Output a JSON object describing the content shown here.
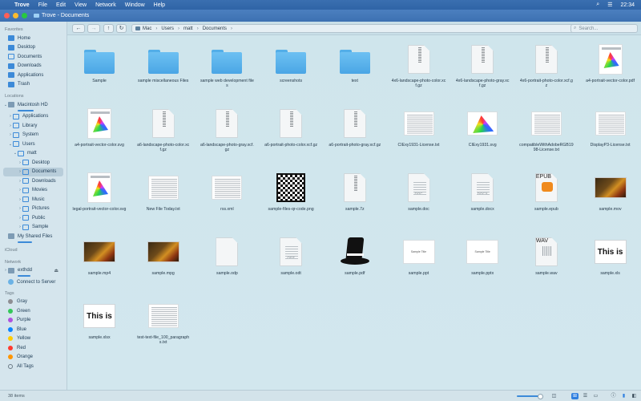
{
  "menubar": {
    "app_name": "Trove",
    "items": [
      "File",
      "Edit",
      "View",
      "Network",
      "Window",
      "Help"
    ],
    "clock": "22:34"
  },
  "window": {
    "title": "Trove - Documents"
  },
  "toolbar": {
    "path": [
      "Mac",
      "Users",
      "matt",
      "Documents"
    ],
    "search_placeholder": "Search..."
  },
  "sidebar": {
    "favorites_header": "Favorites",
    "favorites": [
      "Home",
      "Desktop",
      "Documents",
      "Downloads",
      "Applications",
      "Trash"
    ],
    "locations_header": "Locations",
    "locations": [
      "Macintosh HD",
      "Applications",
      "Library",
      "System",
      "Users",
      "matt",
      "Desktop",
      "Documents",
      "Downloads",
      "Movies",
      "Music",
      "Pictures",
      "Public",
      "Sample",
      "My Shared Files"
    ],
    "icloud_header": "iCloud",
    "network_header": "Network",
    "network": [
      "exthdd",
      "Connect to Server"
    ],
    "tags_header": "Tags",
    "tags": [
      {
        "name": "Gray",
        "color": "#8e8e93"
      },
      {
        "name": "Green",
        "color": "#34c759"
      },
      {
        "name": "Purple",
        "color": "#af52de"
      },
      {
        "name": "Blue",
        "color": "#0a84ff"
      },
      {
        "name": "Yellow",
        "color": "#ffcc00"
      },
      {
        "name": "Red",
        "color": "#ff3b30"
      },
      {
        "name": "Orange",
        "color": "#ff9500"
      },
      {
        "name": "All Tags",
        "color": ""
      }
    ]
  },
  "files": [
    {
      "name": "Sample",
      "kind": "folder"
    },
    {
      "name": "sample miscellaneous Files",
      "kind": "folder"
    },
    {
      "name": "sample web development files",
      "kind": "folder"
    },
    {
      "name": "screenshots",
      "kind": "folder"
    },
    {
      "name": "text",
      "kind": "folder"
    },
    {
      "name": "4x6-landscape-photo-color.xcf.gz",
      "kind": "gz"
    },
    {
      "name": "4x6-landscape-photo-gray.xcf.gz",
      "kind": "gz"
    },
    {
      "name": "4x6-portrait-photo-color.xcf.gz",
      "kind": "gz"
    },
    {
      "name": "a4-portrait-vector-color.pdf",
      "kind": "gamut"
    },
    {
      "name": "a4-portrait-vector-color.svg",
      "kind": "gamut"
    },
    {
      "name": "a6-landscape-photo-color.xcf.gz",
      "kind": "gz"
    },
    {
      "name": "a6-landscape-photo-gray.xcf.gz",
      "kind": "gz"
    },
    {
      "name": "a6-portrait-photo-color.xcf.gz",
      "kind": "gz"
    },
    {
      "name": "a6-portrait-photo-gray.xcf.gz",
      "kind": "gz"
    },
    {
      "name": "CIExy1931-License.txt",
      "kind": "textdoc"
    },
    {
      "name": "CIExy1931.svg",
      "kind": "gamutwide"
    },
    {
      "name": "compatibleWithAdobeRGB1998-License.txt",
      "kind": "textdoc"
    },
    {
      "name": "DisplayP3-License.txt",
      "kind": "textdoc"
    },
    {
      "name": "legal-portrait-vector-color.svg",
      "kind": "gamut"
    },
    {
      "name": "New File Today.txt",
      "kind": "blank"
    },
    {
      "name": "rss.xml",
      "kind": "textdoc"
    },
    {
      "name": "sample-files-qr-code.png",
      "kind": "qr"
    },
    {
      "name": "sample.7z",
      "kind": "gz"
    },
    {
      "name": "sample.doc",
      "kind": "docx",
      "ext": "DOC"
    },
    {
      "name": "sample.docx",
      "kind": "docx",
      "ext": "DOCX"
    },
    {
      "name": "sample.epub",
      "kind": "epub",
      "ext": "EPUB"
    },
    {
      "name": "sample.mov",
      "kind": "photo"
    },
    {
      "name": "sample.mp4",
      "kind": "photo"
    },
    {
      "name": "sample.mpg",
      "kind": "photo"
    },
    {
      "name": "sample.odp",
      "kind": "plain"
    },
    {
      "name": "sample.odt",
      "kind": "odt",
      "ext": "ODT"
    },
    {
      "name": "sample.pdf",
      "kind": "hat"
    },
    {
      "name": "sample.ppt",
      "kind": "slide",
      "slide_text": "Sample Title"
    },
    {
      "name": "sample.pptx",
      "kind": "slide",
      "slide_text": "Sample Title"
    },
    {
      "name": "sample.wav",
      "kind": "wav",
      "ext": "WAV"
    },
    {
      "name": "sample.xls",
      "kind": "thisis",
      "thumb_text": "This is"
    },
    {
      "name": "sample.xlsx",
      "kind": "thisis",
      "thumb_text": "This is"
    },
    {
      "name": "test-text-file_100_paragraphs.txt",
      "kind": "textdoc"
    }
  ],
  "status": {
    "count": "38 items"
  }
}
